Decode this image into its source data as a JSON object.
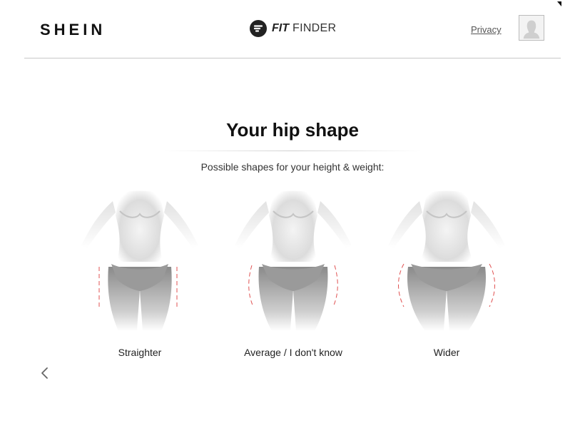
{
  "header": {
    "logo": "SHEIN",
    "fitfinder_fit": "FIT",
    "fitfinder_finder": "FINDER",
    "privacy_label": "Privacy"
  },
  "main": {
    "title": "Your hip shape",
    "subtitle": "Possible shapes for your height & weight:",
    "options": [
      {
        "label": "Straighter"
      },
      {
        "label": "Average / I don't know"
      },
      {
        "label": "Wider"
      }
    ]
  },
  "colors": {
    "guide_line": "#e05050",
    "text": "#111111",
    "divider": "#c8c8c8"
  },
  "icons": {
    "fitfinder": "fitfinder-logo-icon",
    "avatar": "user-silhouette-icon",
    "back": "chevron-left-icon"
  }
}
